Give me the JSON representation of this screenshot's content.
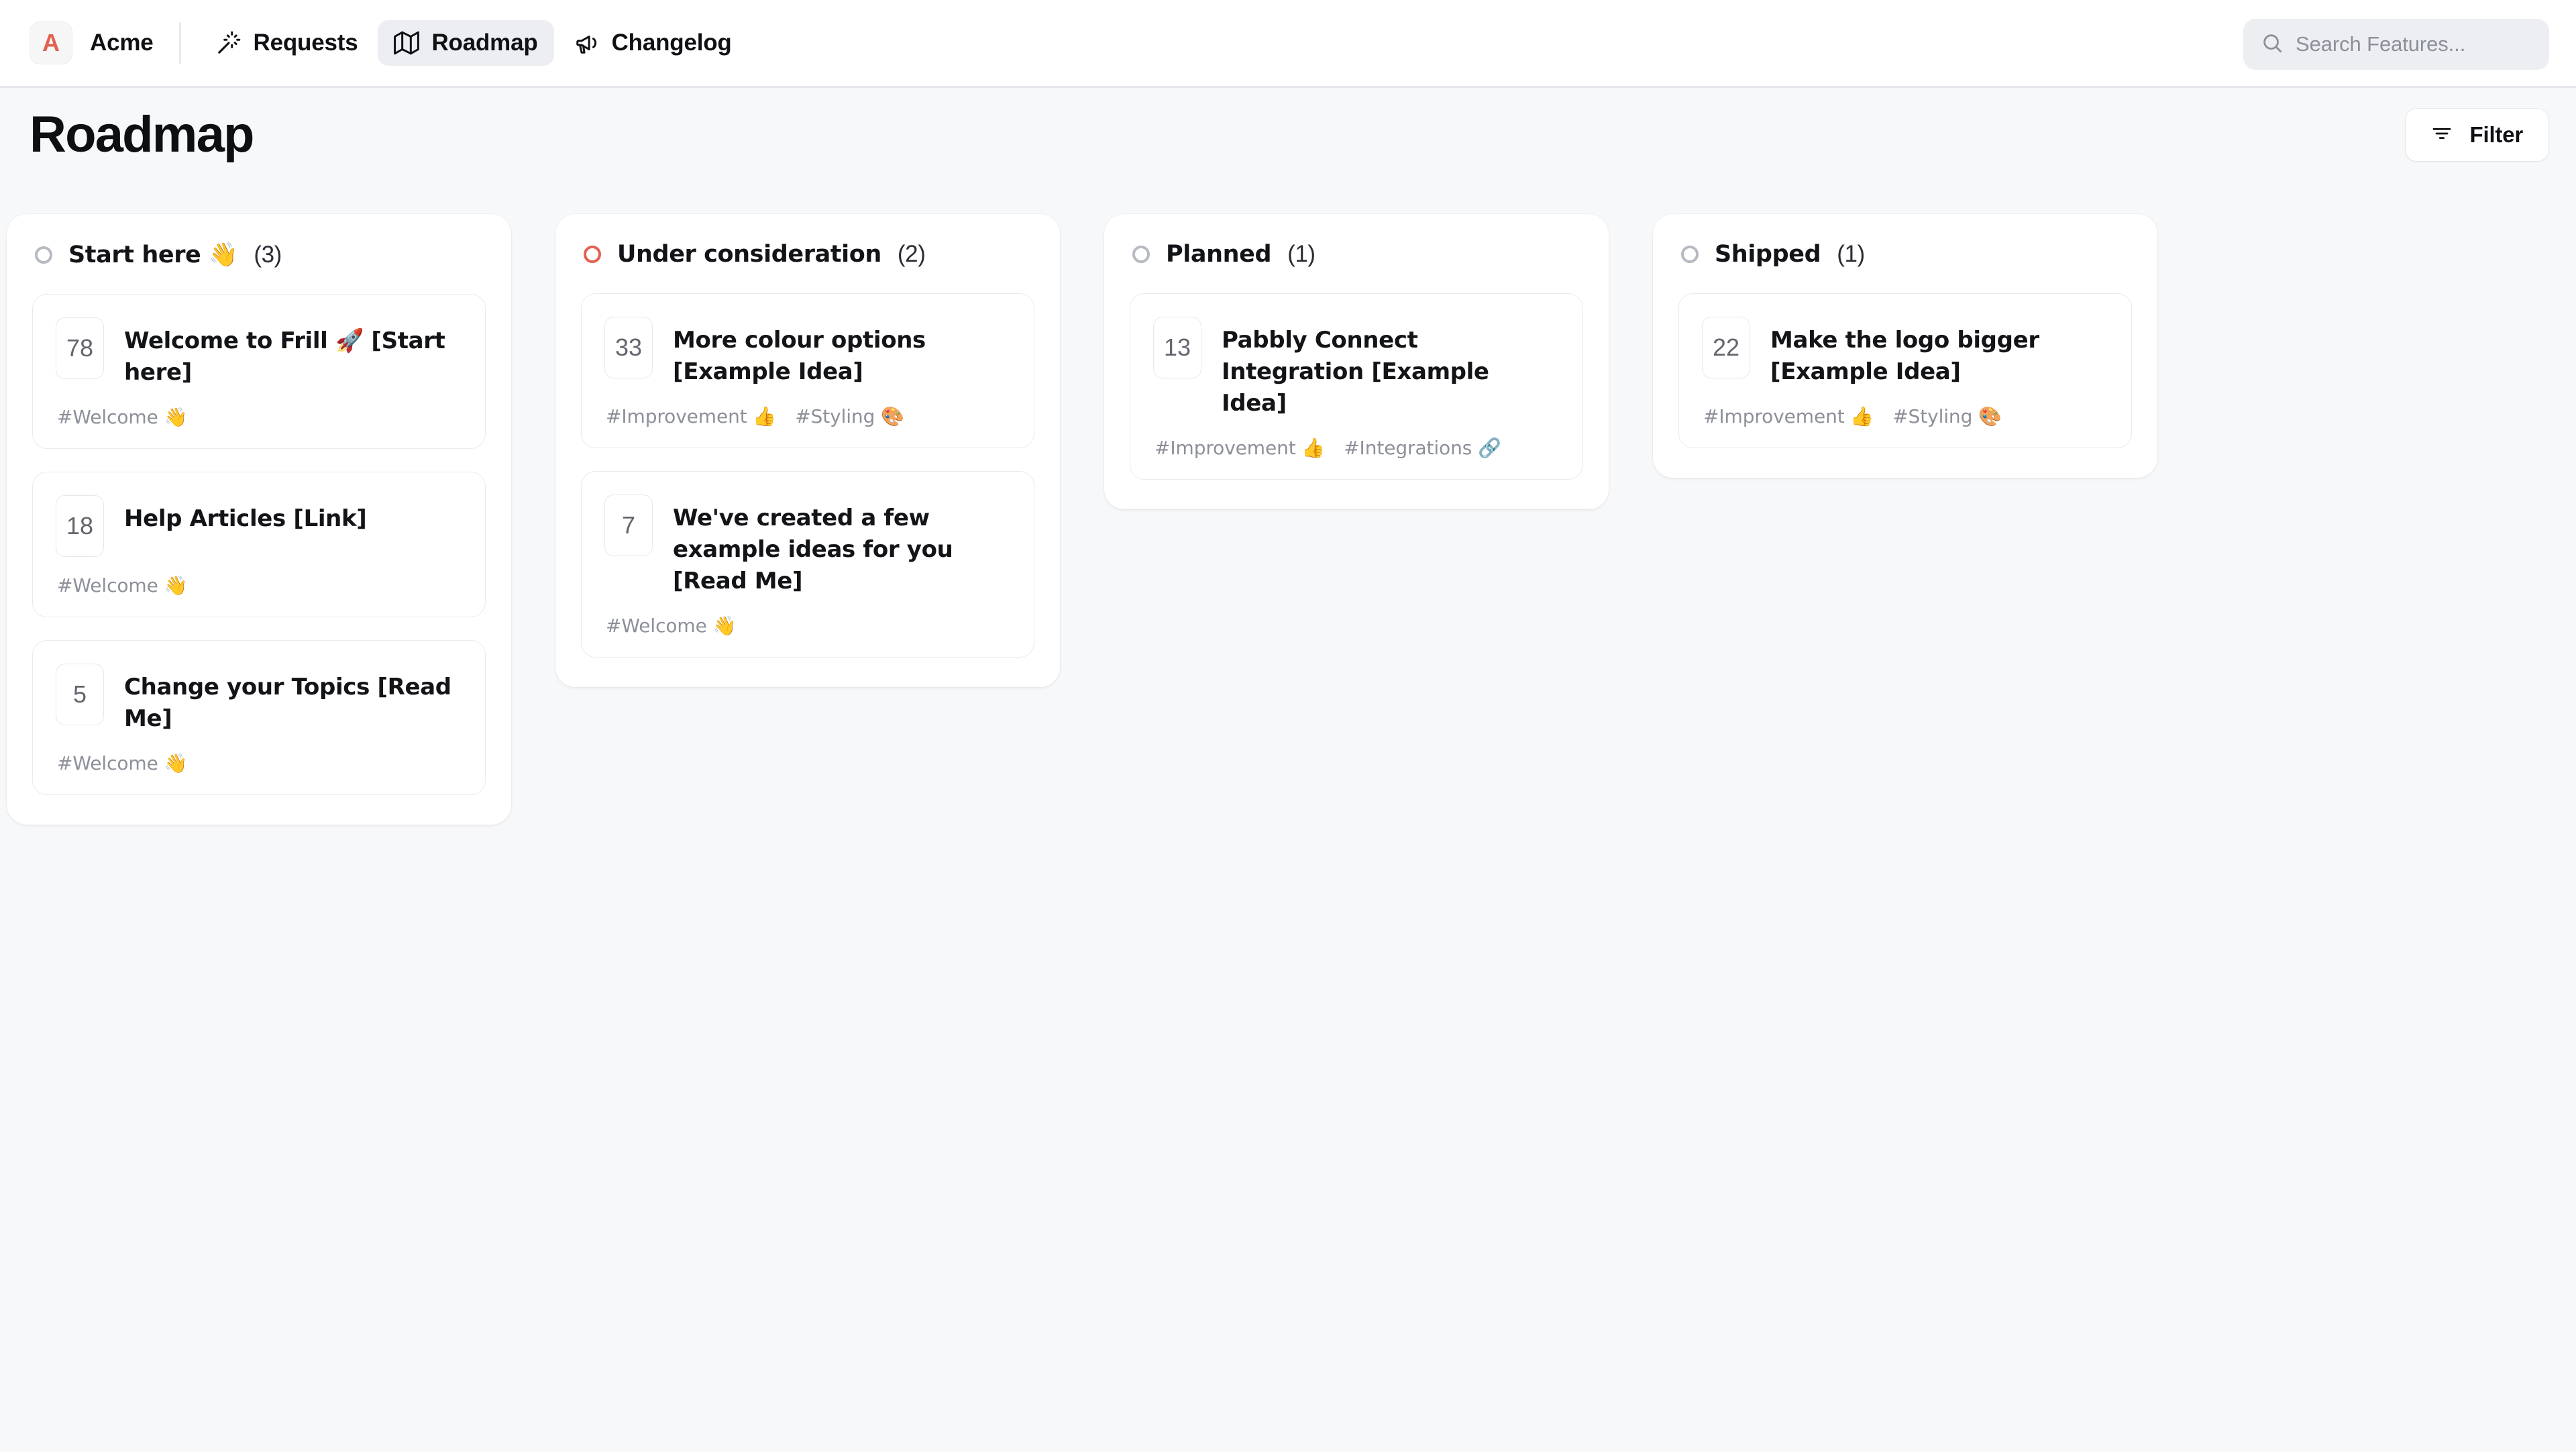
{
  "topbar": {
    "brand_initial": "A",
    "brand_name": "Acme",
    "brand_color": "#e2614f",
    "nav": [
      {
        "id": "requests",
        "label": "Requests",
        "icon": "magic-wand-icon",
        "active": false
      },
      {
        "id": "roadmap",
        "label": "Roadmap",
        "icon": "map-icon",
        "active": true
      },
      {
        "id": "changelog",
        "label": "Changelog",
        "icon": "megaphone-icon",
        "active": false
      }
    ],
    "search": {
      "placeholder": "Search Features...",
      "value": "",
      "icon": "search-icon"
    }
  },
  "page": {
    "title": "Roadmap",
    "filter_label": "Filter",
    "filter_icon": "filter-icon"
  },
  "board": {
    "columns": [
      {
        "id": "start-here",
        "title": "Start here 👋",
        "count": "(3)",
        "dot_color": "#b6bac2",
        "cards": [
          {
            "votes": "78",
            "title": "Welcome to Frill 🚀 [Start here]",
            "tags": [
              "#Welcome 👋"
            ]
          },
          {
            "votes": "18",
            "title": "Help Articles [Link]",
            "tags": [
              "#Welcome 👋"
            ]
          },
          {
            "votes": "5",
            "title": "Change your Topics [Read Me]",
            "tags": [
              "#Welcome 👋"
            ]
          }
        ]
      },
      {
        "id": "under-consideration",
        "title": "Under consideration",
        "count": "(2)",
        "dot_color": "#e2614f",
        "cards": [
          {
            "votes": "33",
            "title": "More colour options [Example Idea]",
            "tags": [
              "#Improvement 👍",
              "#Styling 🎨"
            ]
          },
          {
            "votes": "7",
            "title": "We've created a few example ideas for you [Read Me]",
            "tags": [
              "#Welcome 👋"
            ]
          }
        ]
      },
      {
        "id": "planned",
        "title": "Planned",
        "count": "(1)",
        "dot_color": "#b6bac2",
        "cards": [
          {
            "votes": "13",
            "title": "Pabbly Connect Integration [Example Idea]",
            "tags": [
              "#Improvement 👍",
              "#Integrations 🔗"
            ]
          }
        ]
      },
      {
        "id": "shipped",
        "title": "Shipped",
        "count": "(1)",
        "dot_color": "#b6bac2",
        "cards": [
          {
            "votes": "22",
            "title": "Make the logo bigger [Example Idea]",
            "tags": [
              "#Improvement 👍",
              "#Styling 🎨"
            ]
          }
        ]
      }
    ]
  }
}
